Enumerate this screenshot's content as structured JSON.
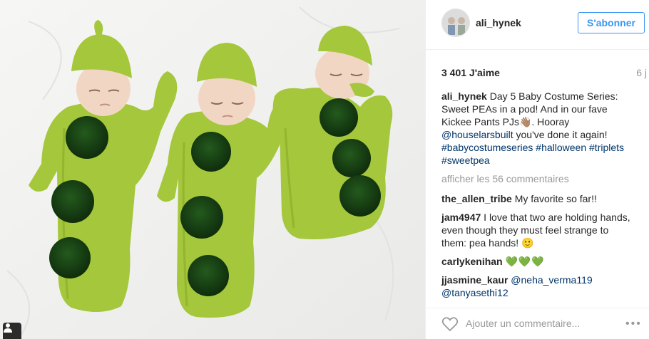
{
  "post": {
    "username": "ali_hynek",
    "follow_label": "S'abonner",
    "likes": "3 401 J'aime",
    "time": "6 j"
  },
  "caption": {
    "user": "ali_hynek",
    "text": "Day 5 Baby Costume Series: Sweet PEAs in a pod! And in our fave Kickee Pants PJs👋🏽. Hooray ",
    "mention": "@houselarsbuilt",
    "text_after": " you've done it again!",
    "hashtags": "#babycostumeseries #halloween #triplets #sweetpea"
  },
  "more_comments": "afficher les 56 commentaires",
  "comments": [
    {
      "user": "the_allen_tribe",
      "text": "My favorite so far!!"
    },
    {
      "user": "jam4947",
      "text": "I love that two are holding hands, even though they must feel strange to them: pea hands! 🙂"
    },
    {
      "user": "carlykenihan",
      "text": "💚💚💚"
    },
    {
      "user": "jjasmine_kaur",
      "mention1": "@neha_verma119",
      "mention2": "@tanyasethi12"
    }
  ],
  "footer": {
    "placeholder": "Ajouter un commentaire...",
    "more": "•••"
  },
  "colors": {
    "accent_blue": "#3897f0",
    "link_dark_blue": "#003569",
    "gown_green": "#a4c73b",
    "pompom_green": "#163e12",
    "muted_text": "#999999"
  },
  "icons": [
    "heart-icon",
    "more-options-icon",
    "user-tag-icon"
  ]
}
